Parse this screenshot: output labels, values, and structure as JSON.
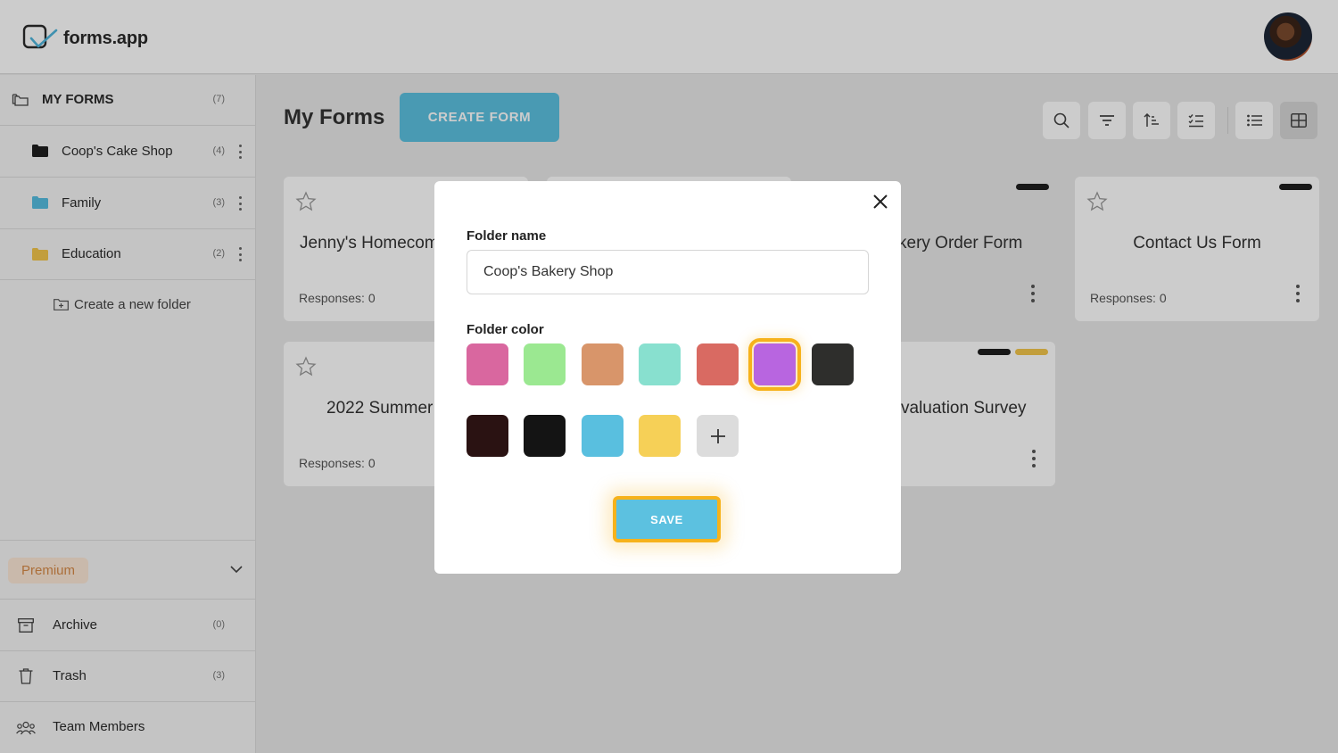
{
  "app": {
    "logo_text": "forms.app"
  },
  "sidebar": {
    "my_forms": {
      "label": "MY FORMS",
      "count": "(7)"
    },
    "folders": [
      {
        "label": "Coop's Cake Shop",
        "count": "(4)",
        "color": "#1f1f1f"
      },
      {
        "label": "Family",
        "count": "(3)",
        "color": "#55bde0"
      },
      {
        "label": "Education",
        "count": "(2)",
        "color": "#f3c64c"
      }
    ],
    "create_folder": "Create a new folder",
    "premium": "Premium",
    "bottom": [
      {
        "label": "Archive",
        "count": "(0)"
      },
      {
        "label": "Trash",
        "count": "(3)"
      },
      {
        "label": "Team Members"
      }
    ]
  },
  "main": {
    "title": "My Forms",
    "create_button": "CREATE FORM",
    "cards": [
      {
        "title": "Jenny's Homecom",
        "responses": "Responses: 0"
      },
      {
        "title": "kery Order Form"
      },
      {
        "title": "Contact Us Form",
        "responses": "Responses: 0"
      },
      {
        "title": "2022 Summer",
        "responses": "Responses: 0"
      },
      {
        "title": "valuation Survey"
      }
    ]
  },
  "modal": {
    "folder_name_label": "Folder name",
    "folder_name_value": "Coop's Bakery Shop",
    "folder_color_label": "Folder color",
    "colors": [
      "#d9679f",
      "#9be891",
      "#d8956a",
      "#88e0cf",
      "#d96a62",
      "#b865e0",
      "#2e2e2c",
      "#2a1212",
      "#141414",
      "#59bfdf",
      "#f6d057"
    ],
    "selected_color": "#b865e0",
    "save_button": "SAVE"
  }
}
